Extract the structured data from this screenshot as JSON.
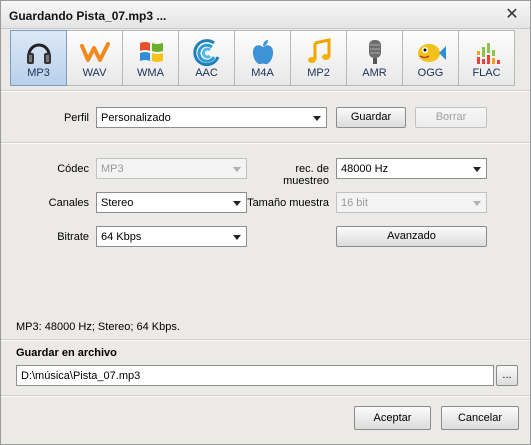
{
  "window": {
    "title": "Guardando Pista_07.mp3 ...",
    "close_symbol": "✕"
  },
  "formats": [
    {
      "label": "MP3",
      "icon": "headphones-icon",
      "active": true
    },
    {
      "label": "WAV",
      "icon": "wav-wave-icon"
    },
    {
      "label": "WMA",
      "icon": "windows-flag-icon"
    },
    {
      "label": "AAC",
      "icon": "aac-swirl-icon"
    },
    {
      "label": "M4A",
      "icon": "apple-icon"
    },
    {
      "label": "MP2",
      "icon": "music-note-icon"
    },
    {
      "label": "AMR",
      "icon": "microphone-icon"
    },
    {
      "label": "OGG",
      "icon": "fish-icon"
    },
    {
      "label": "FLAC",
      "icon": "equalizer-icon"
    }
  ],
  "profile": {
    "label": "Perfil",
    "value": "Personalizado",
    "save_label": "Guardar",
    "delete_label": "Borrar"
  },
  "settings": {
    "codec_label": "Códec",
    "codec_value": "MP3",
    "sample_rate_label": "rec. de muestreo",
    "sample_rate_value": "48000 Hz",
    "channels_label": "Canales",
    "channels_value": "Stereo",
    "sample_size_label": "Tamaño muestra",
    "sample_size_value": "16 bit",
    "bitrate_label": "Bitrate",
    "bitrate_value": "64 Kbps",
    "advanced_label": "Avanzado"
  },
  "summary": "MP3: 48000  Hz; Stereo; 64 Kbps.",
  "save_file": {
    "heading": "Guardar en archivo",
    "path": "D:\\música\\Pista_07.mp3",
    "browse_label": "..."
  },
  "footer": {
    "ok_label": "Aceptar",
    "cancel_label": "Cancelar"
  }
}
